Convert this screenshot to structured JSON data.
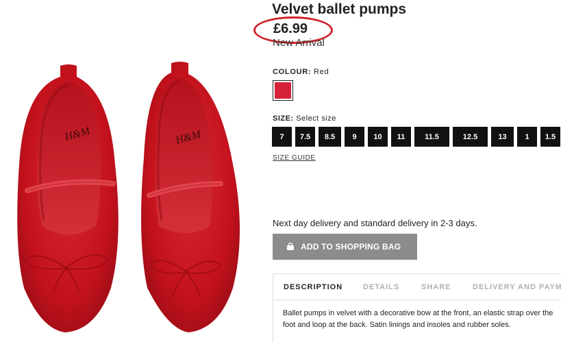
{
  "product": {
    "title": "Velvet ballet pumps",
    "price": "£6.99",
    "badge": "New Arrival",
    "brand_mark": "H&M"
  },
  "colour": {
    "label": "COLOUR:",
    "value": "Red",
    "swatch_color": "#d6213a"
  },
  "size": {
    "label": "SIZE:",
    "hint": "Select size",
    "options": [
      "7",
      "7.5",
      "8.5",
      "9",
      "10",
      "11",
      "11.5",
      "12.5",
      "13",
      "1",
      "1.5"
    ],
    "guide_label": "SIZE GUIDE"
  },
  "delivery": {
    "text": "Next day delivery and standard delivery in 2-3 days."
  },
  "cart": {
    "button_label": "ADD TO SHOPPING BAG",
    "button_color": "#8c8c8c"
  },
  "tabs": [
    {
      "label": "DESCRIPTION",
      "active": true
    },
    {
      "label": "DETAILS",
      "active": false
    },
    {
      "label": "SHARE",
      "active": false
    },
    {
      "label": "DELIVERY AND PAYM",
      "active": false
    }
  ],
  "description": {
    "text": "Ballet pumps in velvet with a decorative bow at the front, an elastic strap over the foot and loop at the back. Satin linings and insoles and rubber soles."
  },
  "highlight": {
    "color": "#d0232a"
  }
}
